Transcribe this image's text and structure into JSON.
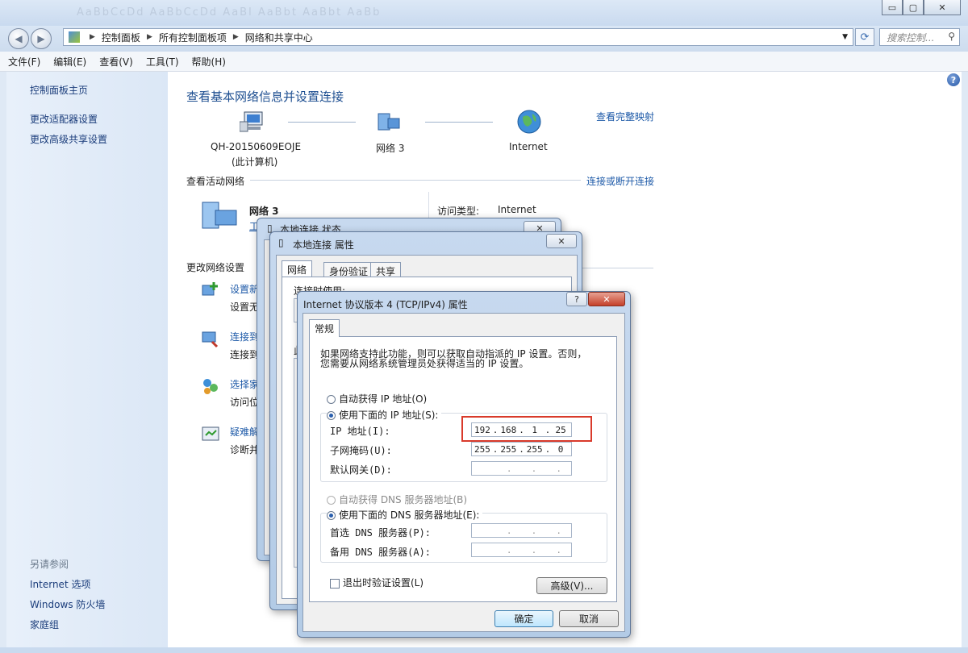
{
  "top_ghost": "AaBbCcDd AaBbCcDd AaBl AaBbt AaBbt AaBb",
  "address": {
    "crumbs": [
      "控制面板",
      "所有控制面板项",
      "网络和共享中心"
    ],
    "search_placeholder": "搜索控制..."
  },
  "menu": [
    "文件(F)",
    "编辑(E)",
    "查看(V)",
    "工具(T)",
    "帮助(H)"
  ],
  "left": {
    "links": [
      "控制面板主页",
      "更改适配器设置",
      "更改高级共享设置"
    ],
    "see_also_title": "另请参阅",
    "see_also": [
      "Internet 选项",
      "Windows 防火墙",
      "家庭组"
    ]
  },
  "main": {
    "title": "查看基本网络信息并设置连接",
    "view_map": "查看完整映射",
    "computer_name": "QH-20150609EOJE",
    "computer_sub": "(此计算机)",
    "network_name": "网络  3",
    "internet": "Internet",
    "active_title": "查看活动网络",
    "connect_link": "连接或断开连接",
    "active_net_name": "网络  3",
    "active_net_sub": "工",
    "access_type_label": "访问类型:",
    "access_type_value": "Internet",
    "change_title": "更改网络设置",
    "tasks": [
      {
        "title": "设置新",
        "desc": "设置无"
      },
      {
        "title": "连接到",
        "desc": "连接到"
      },
      {
        "title": "选择家",
        "desc": "访问位"
      },
      {
        "title": "疑难解",
        "desc": "诊断并"
      }
    ]
  },
  "status_dialog": {
    "title": "本地连接 状态"
  },
  "props_dialog": {
    "title": "本地连接 属性",
    "tabs": [
      "网络",
      "身份验证",
      "共享"
    ],
    "conn_label": "连接时使用:",
    "partial": "此"
  },
  "ipv4_dialog": {
    "title": "Internet 协议版本 4 (TCP/IPv4) 属性",
    "tab": "常规",
    "desc_line1": "如果网络支持此功能，则可以获取自动指派的 IP 设置。否则，",
    "desc_line2": "您需要从网络系统管理员处获得适当的 IP 设置。",
    "auto_ip": "自动获得 IP 地址(O)",
    "manual_ip": "使用下面的 IP 地址(S):",
    "ip_label": "IP 地址(I):",
    "ip_value": [
      "192",
      "168",
      "1",
      "25"
    ],
    "mask_label": "子网掩码(U):",
    "mask_value": [
      "255",
      "255",
      "255",
      "0"
    ],
    "gateway_label": "默认网关(D):",
    "auto_dns": "自动获得 DNS 服务器地址(B)",
    "manual_dns": "使用下面的 DNS 服务器地址(E):",
    "dns1_label": "首选 DNS 服务器(P):",
    "dns2_label": "备用 DNS 服务器(A):",
    "validate": "退出时验证设置(L)",
    "advanced": "高级(V)...",
    "ok": "确定",
    "cancel": "取消",
    "highlight_color": "#d93a2b"
  }
}
